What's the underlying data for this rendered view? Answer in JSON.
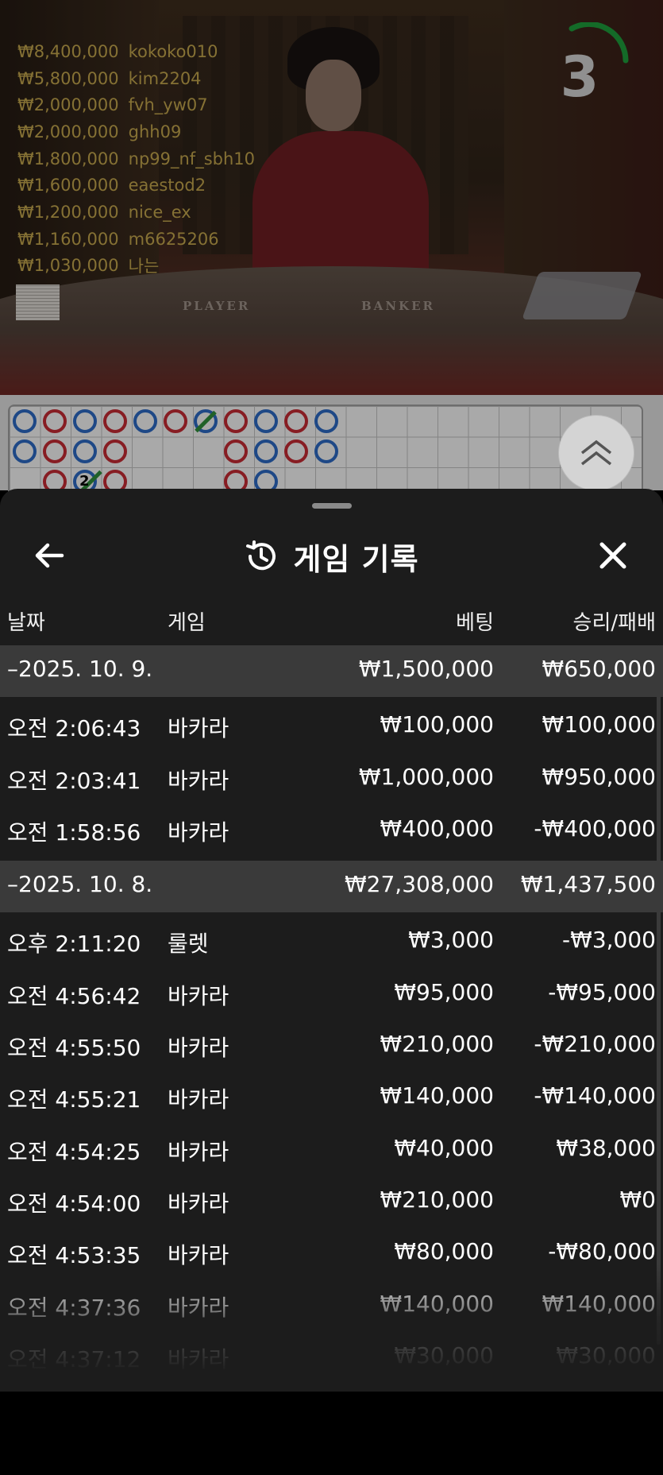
{
  "video": {
    "countdown": "3",
    "table_labels": {
      "player": "PLAYER",
      "banker": "BANKER"
    },
    "leaderboard": [
      {
        "amount": "₩8,400,000",
        "user": "kokoko010"
      },
      {
        "amount": "₩5,800,000",
        "user": "kim2204"
      },
      {
        "amount": "₩2,000,000",
        "user": "fvh_yw07"
      },
      {
        "amount": "₩2,000,000",
        "user": "ghh09"
      },
      {
        "amount": "₩1,800,000",
        "user": "np99_nf_sbh10"
      },
      {
        "amount": "₩1,600,000",
        "user": "eaestod2"
      },
      {
        "amount": "₩1,200,000",
        "user": "nice_ex"
      },
      {
        "amount": "₩1,160,000",
        "user": "m6625206"
      },
      {
        "amount": "₩1,030,000",
        "user": "나는"
      }
    ]
  },
  "roadmap": {
    "tie_count": "2",
    "expand_icon": "double-chevron-up-icon"
  },
  "panel": {
    "title": "게임 기록",
    "title_icon": "history-icon",
    "back_icon": "arrow-left-icon",
    "close_icon": "close-icon",
    "columns": {
      "date": "날짜",
      "game": "게임",
      "bet": "베팅",
      "winloss": "승리/패배"
    },
    "groups": [
      {
        "date": "–2025. 10. 9.",
        "bet_total": "₩1,500,000",
        "win_total": "₩650,000",
        "rows": [
          {
            "time": "오전 2:06:43",
            "game": "바카라",
            "bet": "₩100,000",
            "win": "₩100,000"
          },
          {
            "time": "오전 2:03:41",
            "game": "바카라",
            "bet": "₩1,000,000",
            "win": "₩950,000"
          },
          {
            "time": "오전 1:58:56",
            "game": "바카라",
            "bet": "₩400,000",
            "win": "-₩400,000"
          }
        ]
      },
      {
        "date": "–2025. 10. 8.",
        "bet_total": "₩27,308,000",
        "win_total": "₩1,437,500",
        "rows": [
          {
            "time": "오후 2:11:20",
            "game": "룰렛",
            "bet": "₩3,000",
            "win": "-₩3,000"
          },
          {
            "time": "오전 4:56:42",
            "game": "바카라",
            "bet": "₩95,000",
            "win": "-₩95,000"
          },
          {
            "time": "오전 4:55:50",
            "game": "바카라",
            "bet": "₩210,000",
            "win": "-₩210,000"
          },
          {
            "time": "오전 4:55:21",
            "game": "바카라",
            "bet": "₩140,000",
            "win": "-₩140,000"
          },
          {
            "time": "오전 4:54:25",
            "game": "바카라",
            "bet": "₩40,000",
            "win": "₩38,000"
          },
          {
            "time": "오전 4:54:00",
            "game": "바카라",
            "bet": "₩210,000",
            "win": "₩0"
          },
          {
            "time": "오전 4:53:35",
            "game": "바카라",
            "bet": "₩80,000",
            "win": "-₩80,000"
          },
          {
            "time": "오전 4:37:36",
            "game": "바카라",
            "bet": "₩140,000",
            "win": "₩140,000"
          },
          {
            "time": "오전 4:37:12",
            "game": "바카라",
            "bet": "₩30,000",
            "win": "₩30,000"
          }
        ]
      }
    ]
  }
}
